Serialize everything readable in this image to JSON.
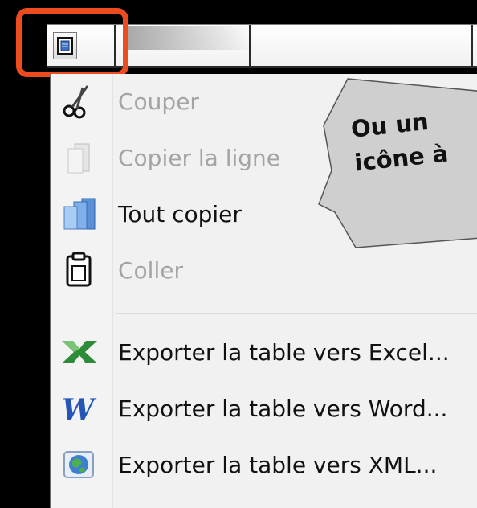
{
  "menu": {
    "items": [
      {
        "label": "Couper",
        "icon": "scissors-icon",
        "enabled": false
      },
      {
        "label": "Copier la ligne",
        "icon": "copy-row-icon",
        "enabled": false
      },
      {
        "label": "Tout copier",
        "icon": "copy-all-icon",
        "enabled": true
      },
      {
        "label": "Coller",
        "icon": "clipboard-icon",
        "enabled": false
      },
      {
        "label": "Exporter la table vers Excel...",
        "icon": "excel-icon",
        "enabled": true
      },
      {
        "label": "Exporter la table vers Word...",
        "icon": "word-icon",
        "enabled": true
      },
      {
        "label": "Exporter la table vers XML...",
        "icon": "xml-globe-icon",
        "enabled": true
      }
    ]
  },
  "callout": {
    "line1": "Ou un",
    "line2": "icône à"
  },
  "colors": {
    "highlight": "#ee4b1e",
    "background": "#000000",
    "menu_background": "#f1f1f1",
    "disabled_text": "#a4a4a4"
  }
}
